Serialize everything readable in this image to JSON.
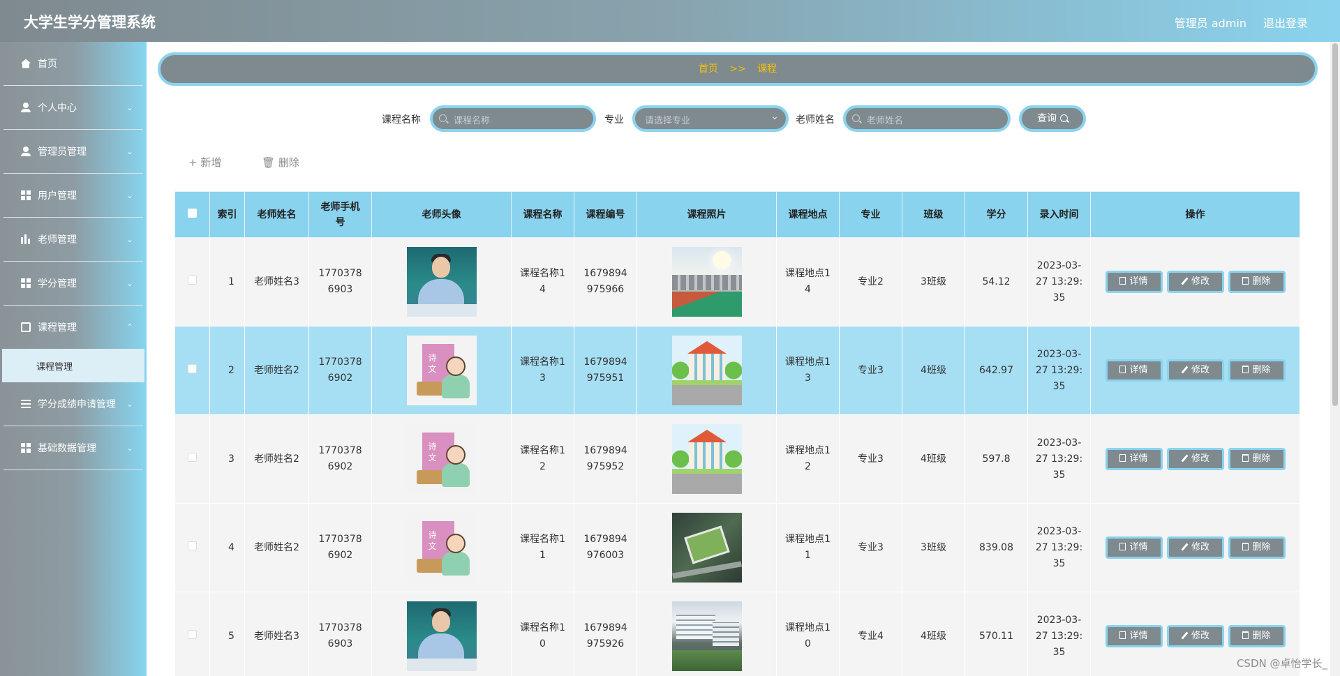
{
  "header": {
    "title": "大学生学分管理系统",
    "admin": "管理员 admin",
    "logout": "退出登录"
  },
  "sidebar": {
    "items": [
      {
        "label": "首页",
        "icon": "home-icon"
      },
      {
        "label": "个人中心",
        "icon": "user-icon"
      },
      {
        "label": "管理员管理",
        "icon": "user-icon"
      },
      {
        "label": "用户管理",
        "icon": "grid-icon"
      },
      {
        "label": "老师管理",
        "icon": "chart-icon"
      },
      {
        "label": "学分管理",
        "icon": "grid-icon"
      },
      {
        "label": "课程管理",
        "icon": "clipboard-icon"
      },
      {
        "label": "学分成绩申请管理",
        "icon": "list-icon"
      },
      {
        "label": "基础数据管理",
        "icon": "grid-icon"
      }
    ],
    "submenu": {
      "label": "课程管理"
    }
  },
  "breadcrumb": {
    "home": "首页",
    "sep": ">>",
    "current": "课程"
  },
  "search": {
    "course_label": "课程名称",
    "course_placeholder": "课程名称",
    "major_label": "专业",
    "major_placeholder": "请选择专业",
    "teacher_label": "老师姓名",
    "teacher_placeholder": "老师姓名",
    "query_label": "查询"
  },
  "actions": {
    "add": "+ 新增",
    "delete": "删除"
  },
  "table": {
    "headers": [
      "",
      "索引",
      "老师姓名",
      "老师手机号",
      "老师头像",
      "课程名称",
      "课程编号",
      "课程照片",
      "课程地点",
      "专业",
      "班级",
      "学分",
      "录入时间",
      "操作"
    ],
    "rows": [
      {
        "idx": "1",
        "teacher": "老师姓名3",
        "phone": "17703786903",
        "avatar": "teacher-photo",
        "course": "课程名称14",
        "code": "1679894975966",
        "photo": "campus-track-photo",
        "place": "课程地点14",
        "major": "专业2",
        "class": "3班级",
        "credit": "54.12",
        "time": "2023-03-27 13:29:35"
      },
      {
        "idx": "2",
        "teacher": "老师姓名2",
        "phone": "17703786902",
        "avatar": "cartoon-teacher",
        "course": "课程名称13",
        "code": "1679894975951",
        "photo": "cartoon-school",
        "place": "课程地点13",
        "major": "专业3",
        "class": "4班级",
        "credit": "642.97",
        "time": "2023-03-27 13:29:35"
      },
      {
        "idx": "3",
        "teacher": "老师姓名2",
        "phone": "17703786902",
        "avatar": "cartoon-teacher",
        "course": "课程名称12",
        "code": "1679894975952",
        "photo": "cartoon-school",
        "place": "课程地点12",
        "major": "专业3",
        "class": "4班级",
        "credit": "597.8",
        "time": "2023-03-27 13:29:35"
      },
      {
        "idx": "4",
        "teacher": "老师姓名2",
        "phone": "17703786902",
        "avatar": "cartoon-teacher",
        "course": "课程名称11",
        "code": "1679894976003",
        "photo": "aerial-campus",
        "place": "课程地点11",
        "major": "专业3",
        "class": "3班级",
        "credit": "839.08",
        "time": "2023-03-27 13:29:35"
      },
      {
        "idx": "5",
        "teacher": "老师姓名3",
        "phone": "17703786903",
        "avatar": "teacher-photo",
        "course": "课程名称10",
        "code": "1679894975926",
        "photo": "campus-buildings",
        "place": "课程地点10",
        "major": "专业4",
        "class": "4班级",
        "credit": "570.11",
        "time": "2023-03-27 13:29:35"
      }
    ],
    "ops": {
      "detail": "详情",
      "edit": "修改",
      "delete": "删除"
    }
  },
  "watermark": "CSDN @卓怡学长_",
  "colors": {
    "accent": "#8ad3ee",
    "control": "#7f8a8f",
    "breadcrumb_text": "#f2c200"
  }
}
